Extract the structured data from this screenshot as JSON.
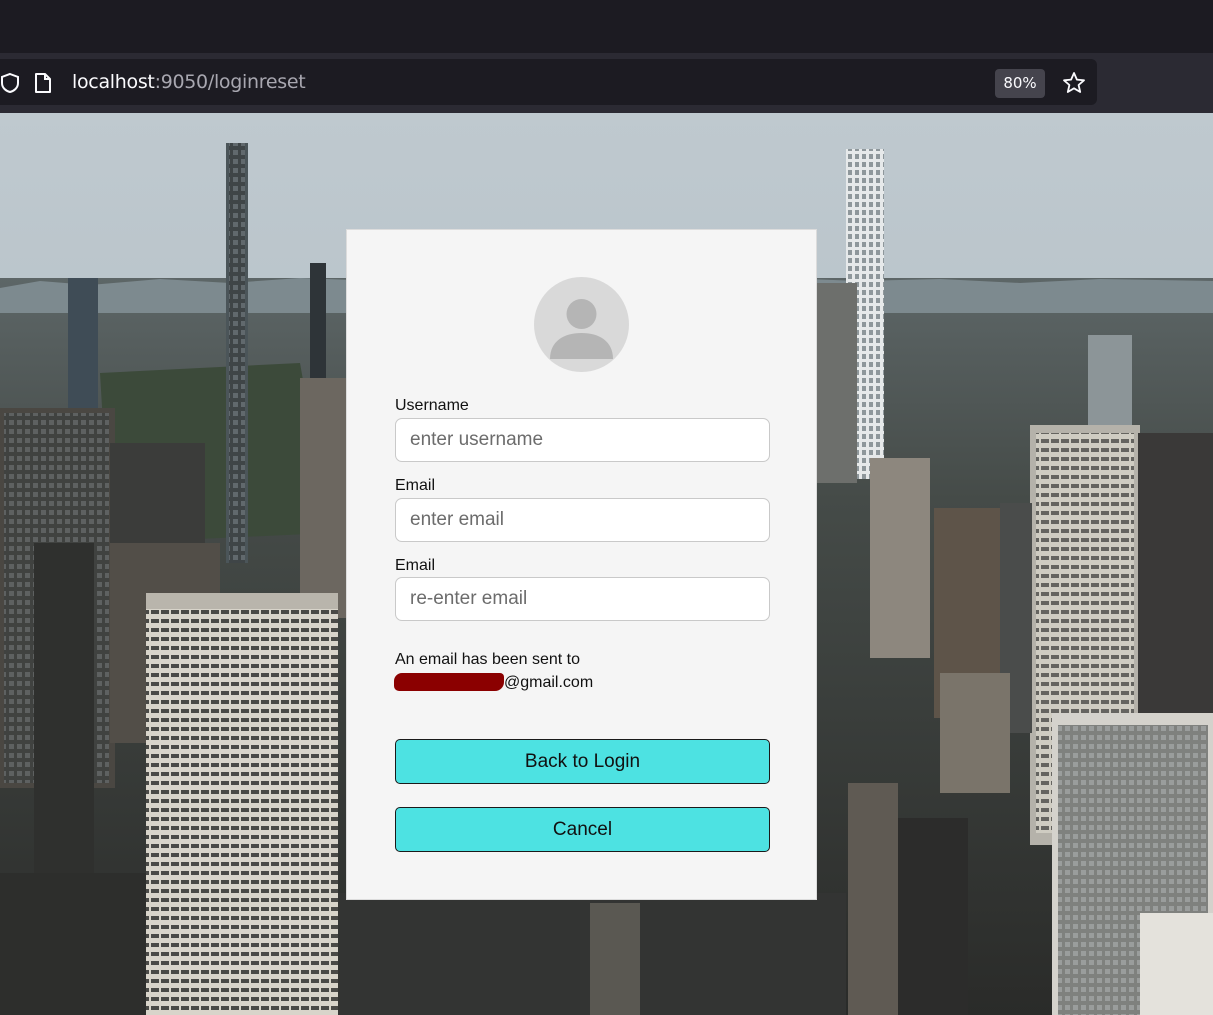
{
  "browser": {
    "url_host": "localhost",
    "url_rest": ":9050/loginreset",
    "zoom": "80%",
    "icons": [
      "shield-icon",
      "page-icon",
      "bookmark-star-icon"
    ]
  },
  "form": {
    "username_label": "Username",
    "username_placeholder": "enter username",
    "email_label": "Email",
    "email_placeholder": "enter email",
    "email_confirm_label": "Email",
    "email_confirm_placeholder": "re-enter email",
    "message_line1": "An email has been sent to",
    "message_domain": "@gmail.com",
    "back_button": "Back to Login",
    "cancel_button": "Cancel"
  },
  "colors": {
    "button_bg": "#4de2e2",
    "card_bg": "#f5f5f5",
    "redaction": "#8b0000"
  }
}
